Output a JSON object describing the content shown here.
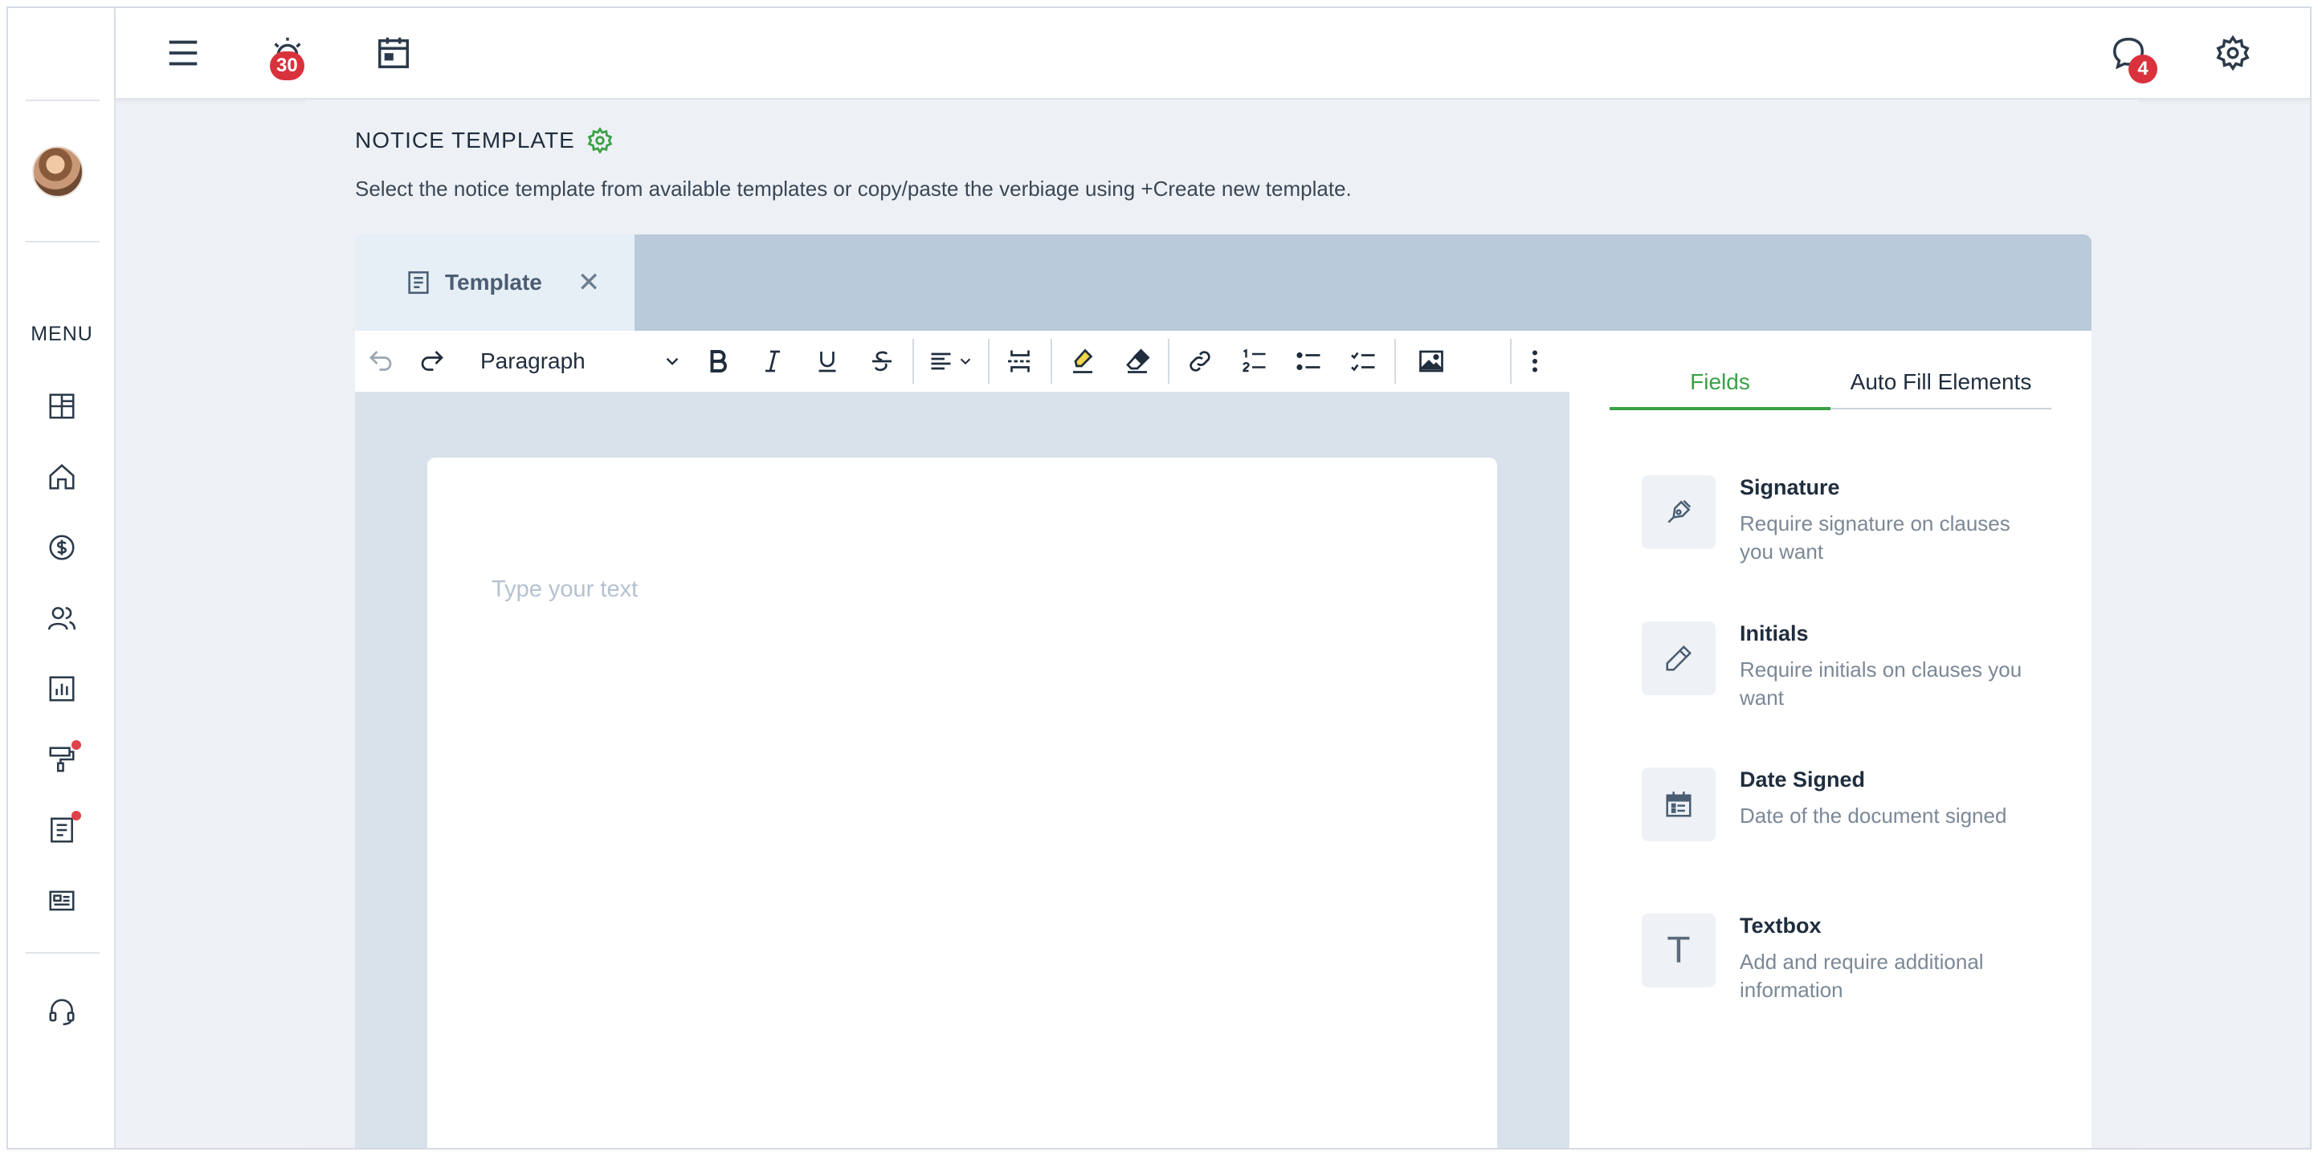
{
  "topbar": {
    "alarm_badge": "30",
    "chat_badge": "4"
  },
  "sidebar": {
    "menu_label": "MENU",
    "items": [
      {
        "name": "dashboard"
      },
      {
        "name": "home"
      },
      {
        "name": "payments"
      },
      {
        "name": "people"
      },
      {
        "name": "reports"
      },
      {
        "name": "maintenance",
        "dot": true
      },
      {
        "name": "documents",
        "dot": true
      },
      {
        "name": "listings"
      }
    ]
  },
  "page": {
    "title": "NOTICE TEMPLATE",
    "subtitle": "Select the notice template from available templates or copy/paste the verbiage using +Create new template."
  },
  "editor": {
    "tab_label": "Template",
    "paragraph_select": "Paragraph",
    "placeholder": "Type your text"
  },
  "side_panel": {
    "tabs": [
      "Fields",
      "Auto Fill Elements"
    ],
    "active_tab": "Fields",
    "fields": [
      {
        "title": "Signature",
        "desc": "Require signature on clauses you want",
        "icon": "pen-nib-icon"
      },
      {
        "title": "Initials",
        "desc": "Require initials on clauses you want",
        "icon": "pencil-icon"
      },
      {
        "title": "Date Signed",
        "desc": "Date of the document signed",
        "icon": "calendar-icon"
      },
      {
        "title": "Textbox",
        "desc": "Add and require additional information",
        "icon": "text-T-icon"
      }
    ]
  },
  "colors": {
    "accent_green": "#3aa146",
    "badge_red": "#d9323c",
    "tab_strip": "#b9cbda"
  }
}
